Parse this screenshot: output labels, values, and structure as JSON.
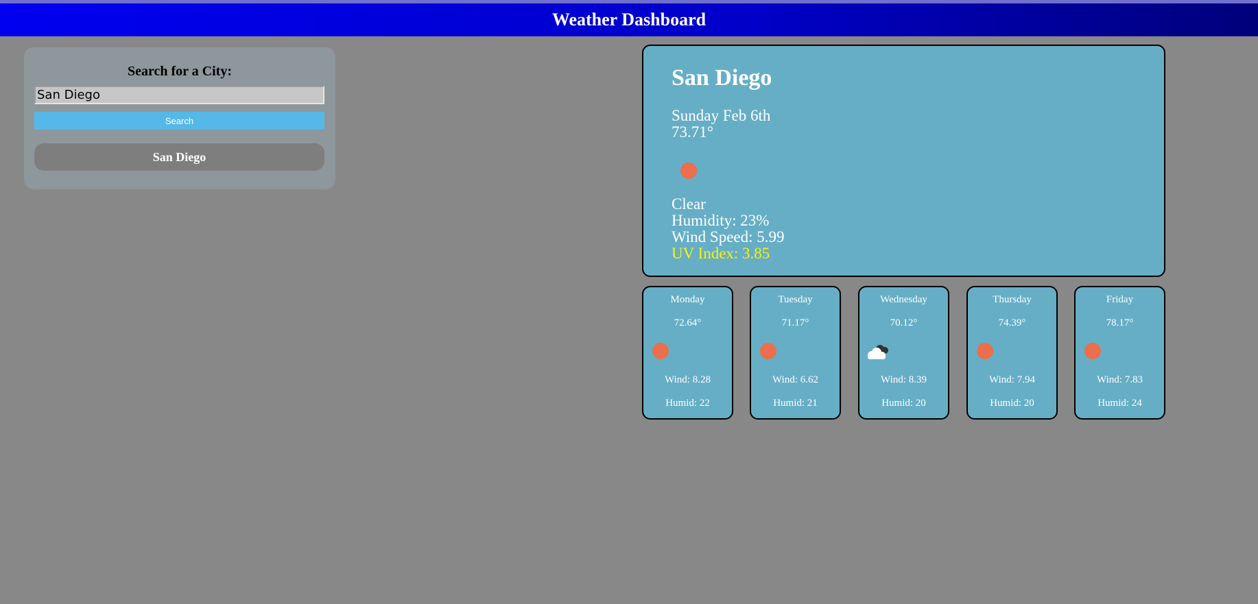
{
  "header": {
    "title": "Weather Dashboard"
  },
  "search": {
    "label": "Search for a City:",
    "input_value": "San Diego",
    "button_label": "Search"
  },
  "history": [
    {
      "label": "San Diego"
    }
  ],
  "current": {
    "city": "San Diego",
    "date": "Sunday Feb 6th",
    "temp": "73.71°",
    "icon": "sun-icon",
    "condition": "Clear",
    "humidity": "Humidity: 23%",
    "wind": "Wind Speed: 5.99",
    "uv": "UV Index: 3.85"
  },
  "forecast": [
    {
      "day": "Monday",
      "temp": "72.64°",
      "icon": "sun-icon",
      "wind": "Wind: 8.28",
      "humid": "Humid: 22"
    },
    {
      "day": "Tuesday",
      "temp": "71.17°",
      "icon": "sun-icon",
      "wind": "Wind: 6.62",
      "humid": "Humid: 21"
    },
    {
      "day": "Wednesday",
      "temp": "70.12°",
      "icon": "cloud-icon",
      "wind": "Wind: 8.39",
      "humid": "Humid: 20"
    },
    {
      "day": "Thursday",
      "temp": "74.39°",
      "icon": "sun-icon",
      "wind": "Wind: 7.94",
      "humid": "Humid: 20"
    },
    {
      "day": "Friday",
      "temp": "78.17°",
      "icon": "sun-icon",
      "wind": "Wind: 7.83",
      "humid": "Humid: 24"
    }
  ],
  "colors": {
    "header_start": "#0000f0",
    "header_end": "#00007a",
    "background": "#888888",
    "panel": "#8e979b",
    "card": "#66aec6",
    "search_button": "#55b8e8",
    "history_button": "#7e7e7e",
    "uv_text": "#fff200",
    "sun": "#ec6e4c"
  }
}
